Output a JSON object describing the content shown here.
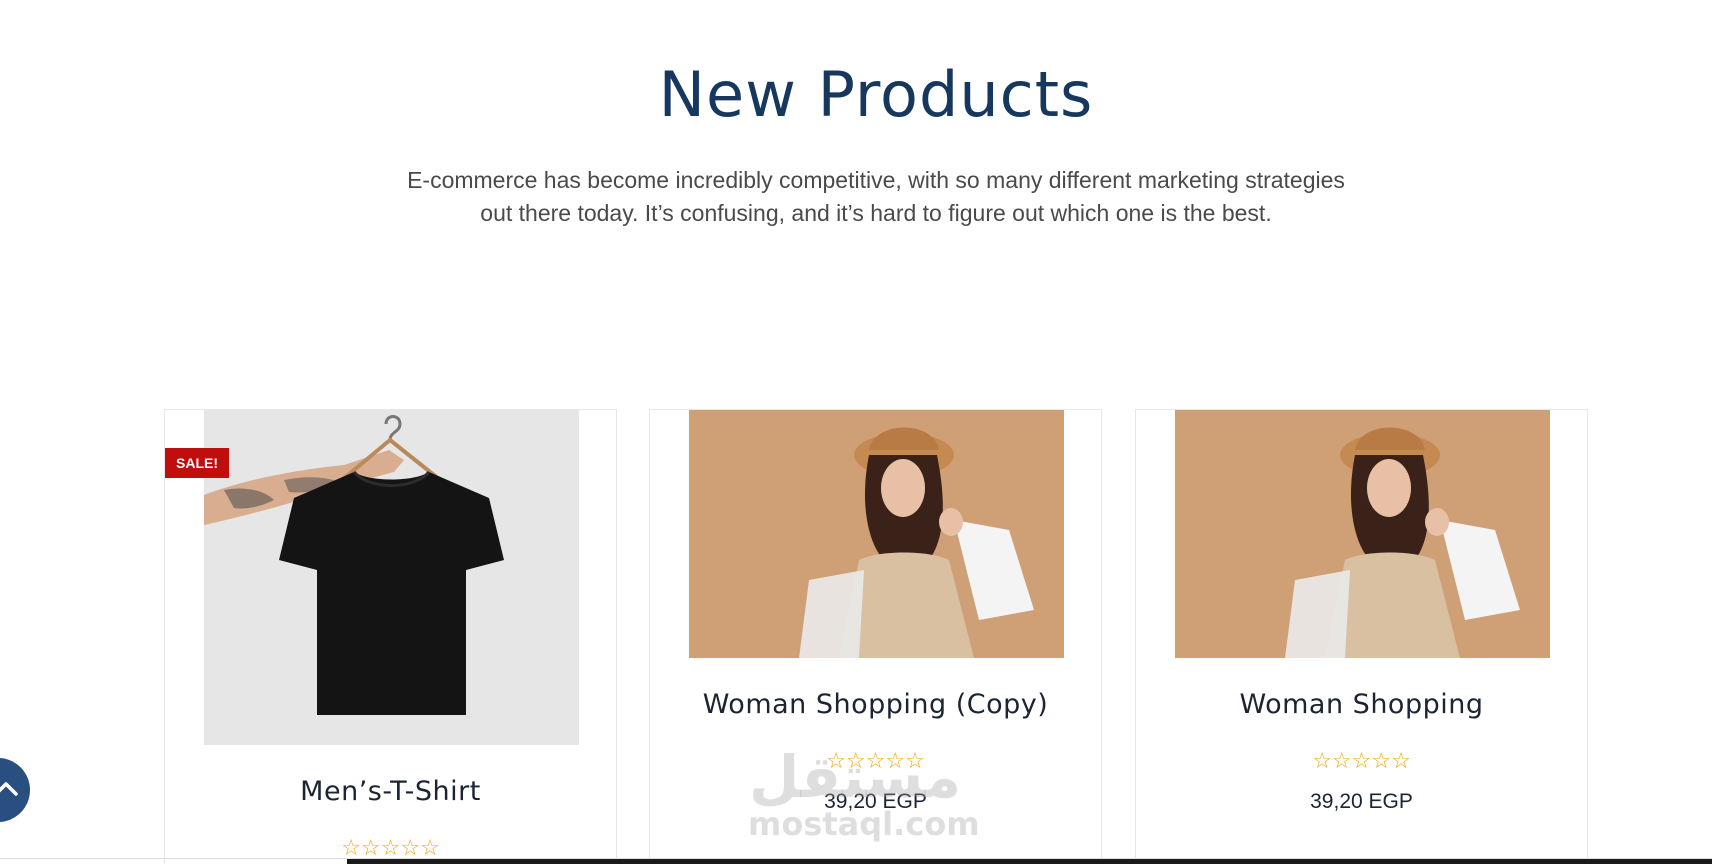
{
  "section": {
    "title": "New Products",
    "description": "E-commerce has become incredibly competitive, with so many different marketing strategies out there today. It’s confusing, and it’s hard to figure out which one is the best."
  },
  "products": [
    {
      "title": "Men’s-T-Shirt",
      "badge": "SALE!",
      "rating_stars": "☆☆☆☆☆",
      "rating": 0,
      "image_icon": "black-tshirt-on-hanger"
    },
    {
      "title": "Woman Shopping (Copy)",
      "rating_stars": "☆☆☆☆☆",
      "rating": 0,
      "price": "39,20 EGP",
      "image_icon": "woman-with-shopping-bags"
    },
    {
      "title": "Woman Shopping",
      "rating_stars": "☆☆☆☆☆",
      "rating": 0,
      "price": "39,20 EGP",
      "image_icon": "woman-with-shopping-bags"
    }
  ],
  "watermark": {
    "arabic": "مستقل",
    "latin": "mostaql.com"
  },
  "colors": {
    "title": "#16385e",
    "badge": "#c00d0d",
    "stars": "#f2a612",
    "back_to_top": "#284f80",
    "product_bg": "#cf9f76"
  },
  "back_to_top_icon": "chevron-up-icon"
}
